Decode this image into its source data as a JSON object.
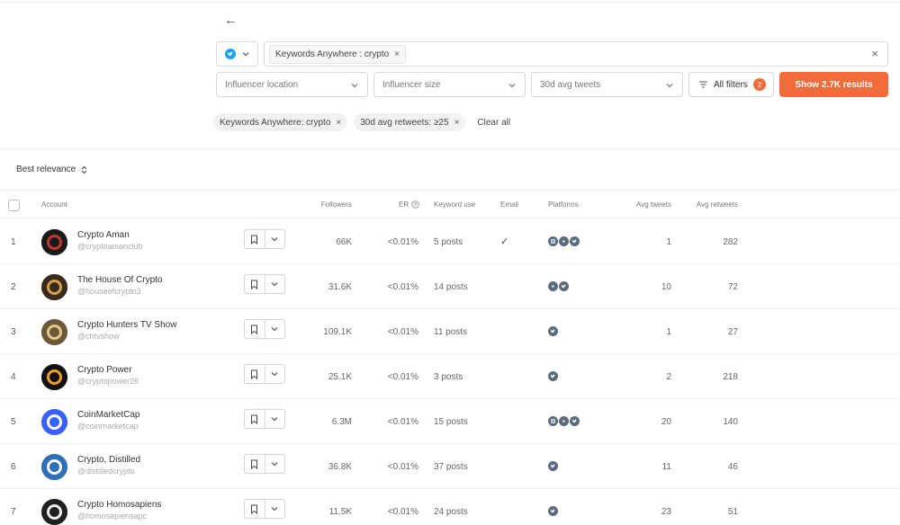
{
  "nav": {
    "back_icon": "←"
  },
  "search": {
    "network": "twitter-icon",
    "keyword_chip": "Keywords Anywhere : crypto",
    "clear_icon": "×"
  },
  "filters": {
    "location": "Influencer location",
    "size": "Influencer size",
    "avg_tweets": "30d avg tweets",
    "all_filters_label": "All filters",
    "all_filters_count": "2",
    "show_results": "Show 2.7K results"
  },
  "active_chips": [
    {
      "label": "Keywords Anywhere: crypto"
    },
    {
      "label": "30d avg retweets: ≥25"
    }
  ],
  "clear_all": "Clear all",
  "sort": {
    "label": "Best relevance"
  },
  "columns": {
    "account": "Account",
    "followers": "Followers",
    "er": "ER",
    "keyword_use": "Keyword use",
    "email": "Email",
    "platforms": "Platforms",
    "avg_tweets": "Avg tweets",
    "avg_retweets": "Avg retweets"
  },
  "rows": [
    {
      "index": "1",
      "name": "Crypto Aman",
      "handle": "@cryptoamanclub",
      "followers": "66K",
      "er": "<0.01%",
      "keyword_use": "5 posts",
      "email": "✓",
      "platforms": [
        "instagram",
        "youtube",
        "twitter"
      ],
      "avg_tweets": "1",
      "avg_retweets": "282",
      "avatar_color": "#1a1a1a",
      "avatar_accent": "#c0392b"
    },
    {
      "index": "2",
      "name": "The House Of Crypto",
      "handle": "@houseofcrypto3",
      "followers": "31.6K",
      "er": "<0.01%",
      "keyword_use": "14 posts",
      "email": "",
      "platforms": [
        "youtube",
        "twitter"
      ],
      "avg_tweets": "10",
      "avg_retweets": "72",
      "avatar_color": "#3a2a1e",
      "avatar_accent": "#d4a04a"
    },
    {
      "index": "3",
      "name": "Crypto Hunters TV Show",
      "handle": "@chtvshow",
      "followers": "109.1K",
      "er": "<0.01%",
      "keyword_use": "11 posts",
      "email": "",
      "platforms": [
        "twitter"
      ],
      "avg_tweets": "1",
      "avg_retweets": "27",
      "avatar_color": "#6b5a3a",
      "avatar_accent": "#e2c98a"
    },
    {
      "index": "4",
      "name": "Crypto Power",
      "handle": "@cryptopower26",
      "followers": "25.1K",
      "er": "<0.01%",
      "keyword_use": "3 posts",
      "email": "",
      "platforms": [
        "twitter"
      ],
      "avg_tweets": "2",
      "avg_retweets": "218",
      "avatar_color": "#111111",
      "avatar_accent": "#f0a020"
    },
    {
      "index": "5",
      "name": "CoinMarketCap",
      "handle": "@coinmarketcap",
      "followers": "6.3M",
      "er": "<0.01%",
      "keyword_use": "15 posts",
      "email": "",
      "platforms": [
        "instagram",
        "youtube",
        "twitter"
      ],
      "avg_tweets": "20",
      "avg_retweets": "140",
      "avatar_color": "#3861fb",
      "avatar_accent": "#ffffff"
    },
    {
      "index": "6",
      "name": "Crypto, Distilled",
      "handle": "@distilledcrypto",
      "followers": "36.8K",
      "er": "<0.01%",
      "keyword_use": "37 posts",
      "email": "",
      "platforms": [
        "twitter"
      ],
      "avg_tweets": "11",
      "avg_retweets": "46",
      "avatar_color": "#2f6fb8",
      "avatar_accent": "#ffffff"
    },
    {
      "index": "7",
      "name": "Crypto Homosapiens",
      "handle": "@homosapiensapc",
      "followers": "11.5K",
      "er": "<0.01%",
      "keyword_use": "24 posts",
      "email": "",
      "platforms": [
        "twitter"
      ],
      "avg_tweets": "23",
      "avg_retweets": "51",
      "avatar_color": "#202020",
      "avatar_accent": "#eeeeee"
    }
  ]
}
